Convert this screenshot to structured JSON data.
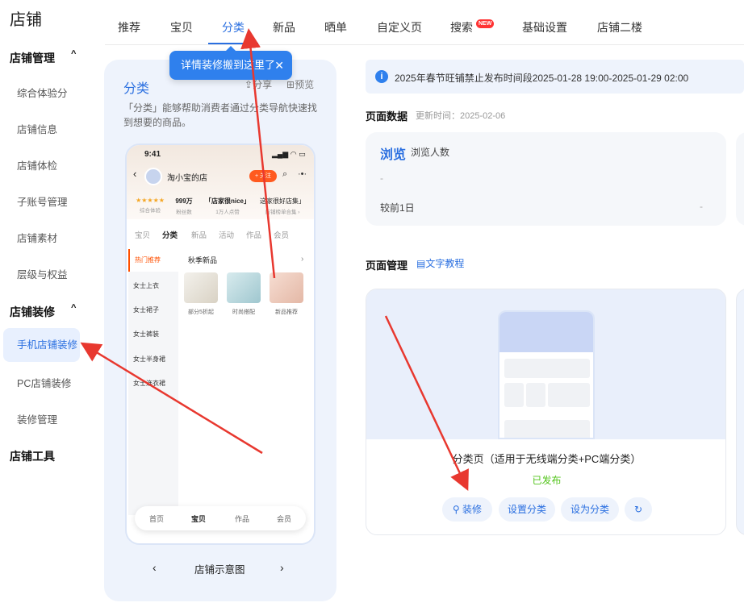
{
  "sidebar": {
    "title": "店铺",
    "sections": [
      {
        "label": "店铺管理",
        "chevron": "^",
        "items": [
          "综合体验分",
          "店铺信息",
          "店铺体检",
          "子账号管理",
          "店铺素材",
          "层级与权益"
        ]
      },
      {
        "label": "店铺装修",
        "chevron": "^",
        "items": [
          "手机店铺装修",
          "PC店铺装修",
          "装修管理"
        ]
      },
      {
        "label": "店铺工具"
      }
    ]
  },
  "tabs": [
    "推荐",
    "宝贝",
    "分类",
    "新品",
    "晒单",
    "自定义页",
    "搜索",
    "基础设置",
    "店铺二楼"
  ],
  "active_tab": "分类",
  "new_badge": "NEW",
  "tooltip": {
    "text": "详情装修搬到这里了",
    "close": "✕"
  },
  "left_panel": {
    "title": "分类",
    "share": "分享",
    "preview": "预览",
    "description": "「分类」能够帮助消费者通过分类导航快速找到想要的商品。",
    "footer_label": "店铺示意图",
    "prev": "‹",
    "next": "›",
    "phone": {
      "time": "9:41",
      "status": "▂▄▆ ◠ ▭",
      "back": "‹",
      "shop": "淘小宝的店",
      "follow": "+ 关注",
      "search": "⌕",
      "more": "·•·",
      "stats": [
        {
          "value": "★★★★★",
          "label": "综合体验"
        },
        {
          "value": "999万",
          "label": "粉丝数"
        },
        {
          "value": "「店家很nice」",
          "label": "1万人点赞"
        },
        {
          "value": "这家很好店集」",
          "label": "店铺榜单合集 ›"
        }
      ],
      "tabs": [
        "宝贝",
        "分类",
        "新品",
        "活动",
        "作品",
        "会员"
      ],
      "active_tab": "分类",
      "categories": [
        "热门推荐",
        "女士上衣",
        "女士裙子",
        "女士裤装",
        "女士半身裙",
        "女士连衣裙"
      ],
      "subcategory": "秋季新品",
      "subcategory_arrow": "›",
      "products": [
        "部分5折起",
        "时尚搭配",
        "新品推荐"
      ],
      "nav": [
        "首页",
        "宝贝",
        "作品",
        "会员"
      ],
      "active_nav": "宝贝"
    }
  },
  "notice": {
    "icon": "i",
    "text": "2025年春节旺铺禁止发布时间段2025-01-28 19:00-2025-01-29 02:00"
  },
  "page_data": {
    "title": "页面数据",
    "updated": "更新时间：2025-02-06",
    "card": {
      "title": "浏览",
      "subtitle": "浏览人数",
      "value": "-",
      "compare_label": "较前1日",
      "compare_value": "-"
    }
  },
  "page_manage": {
    "title": "页面管理",
    "tutorial": "文字教程",
    "card": {
      "name": "分类页（适用于无线端分类+PC端分类）",
      "status": "已发布",
      "buttons": [
        "装修",
        "设置分类",
        "设为分类"
      ]
    }
  },
  "colors": {
    "accent": "#2a6fe0",
    "arrow": "#e8382f",
    "published": "#52c41a"
  }
}
